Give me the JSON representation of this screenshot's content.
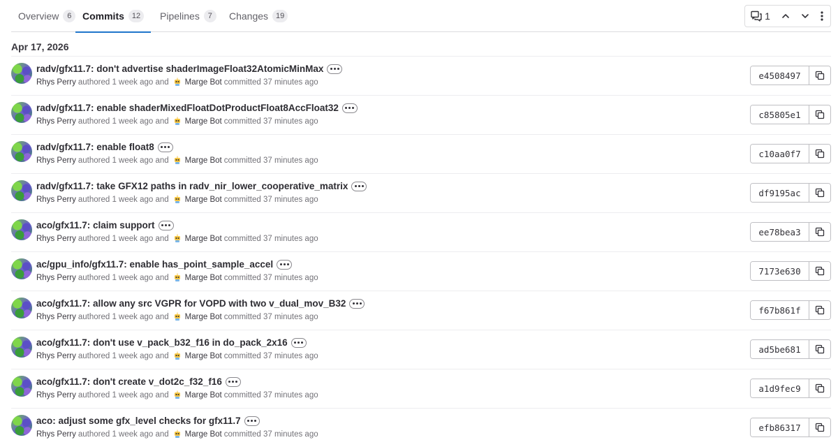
{
  "tabs": [
    {
      "label": "Overview",
      "count": "6"
    },
    {
      "label": "Commits",
      "count": "12"
    },
    {
      "label": "Pipelines",
      "count": "7"
    },
    {
      "label": "Changes",
      "count": "19"
    }
  ],
  "active_tab": "Commits",
  "toolbar": {
    "discussion_count": "1"
  },
  "date_header": "Apr 17, 2026",
  "commits": [
    {
      "title": "radv/gfx11.7: don't advertise shaderImageFloat32AtomicMinMax",
      "author": "Rhys Perry",
      "authored_text": "authored 1 week ago and",
      "committer": "Marge Bot",
      "committed_text": "committed 37 minutes ago",
      "sha": "e4508497"
    },
    {
      "title": "radv/gfx11.7: enable shaderMixedFloatDotProductFloat8AccFloat32",
      "author": "Rhys Perry",
      "authored_text": "authored 1 week ago and",
      "committer": "Marge Bot",
      "committed_text": "committed 37 minutes ago",
      "sha": "c85805e1"
    },
    {
      "title": "radv/gfx11.7: enable float8",
      "author": "Rhys Perry",
      "authored_text": "authored 1 week ago and",
      "committer": "Marge Bot",
      "committed_text": "committed 37 minutes ago",
      "sha": "c10aa0f7"
    },
    {
      "title": "radv/gfx11.7: take GFX12 paths in radv_nir_lower_cooperative_matrix",
      "author": "Rhys Perry",
      "authored_text": "authored 1 week ago and",
      "committer": "Marge Bot",
      "committed_text": "committed 37 minutes ago",
      "sha": "df9195ac"
    },
    {
      "title": "aco/gfx11.7: claim support",
      "author": "Rhys Perry",
      "authored_text": "authored 1 week ago and",
      "committer": "Marge Bot",
      "committed_text": "committed 37 minutes ago",
      "sha": "ee78bea3"
    },
    {
      "title": "ac/gpu_info/gfx11.7: enable has_point_sample_accel",
      "author": "Rhys Perry",
      "authored_text": "authored 1 week ago and",
      "committer": "Marge Bot",
      "committed_text": "committed 37 minutes ago",
      "sha": "7173e630"
    },
    {
      "title": "aco/gfx11.7: allow any src VGPR for VOPD with two v_dual_mov_B32",
      "author": "Rhys Perry",
      "authored_text": "authored 1 week ago and",
      "committer": "Marge Bot",
      "committed_text": "committed 37 minutes ago",
      "sha": "f67b861f"
    },
    {
      "title": "aco/gfx11.7: don't use v_pack_b32_f16 in do_pack_2x16",
      "author": "Rhys Perry",
      "authored_text": "authored 1 week ago and",
      "committer": "Marge Bot",
      "committed_text": "committed 37 minutes ago",
      "sha": "ad5be681"
    },
    {
      "title": "aco/gfx11.7: don't create v_dot2c_f32_f16",
      "author": "Rhys Perry",
      "authored_text": "authored 1 week ago and",
      "committer": "Marge Bot",
      "committed_text": "committed 37 minutes ago",
      "sha": "a1d9fec9"
    },
    {
      "title": "aco: adjust some gfx_level checks for gfx11.7",
      "author": "Rhys Perry",
      "authored_text": "authored 1 week ago and",
      "committer": "Marge Bot",
      "committed_text": "committed 37 minutes ago",
      "sha": "efb86317"
    }
  ],
  "icons": {
    "discussion": "comments-icon",
    "prev": "chevron-up-icon",
    "next": "chevron-down-icon",
    "more": "kebab-menu-icon",
    "copy": "copy-icon",
    "bot": "bot-avatar-icon"
  },
  "colors": {
    "active_tab_underline": "#1f75cb",
    "text": "#333238",
    "muted_text": "#737278",
    "border": "#dcdcde"
  }
}
